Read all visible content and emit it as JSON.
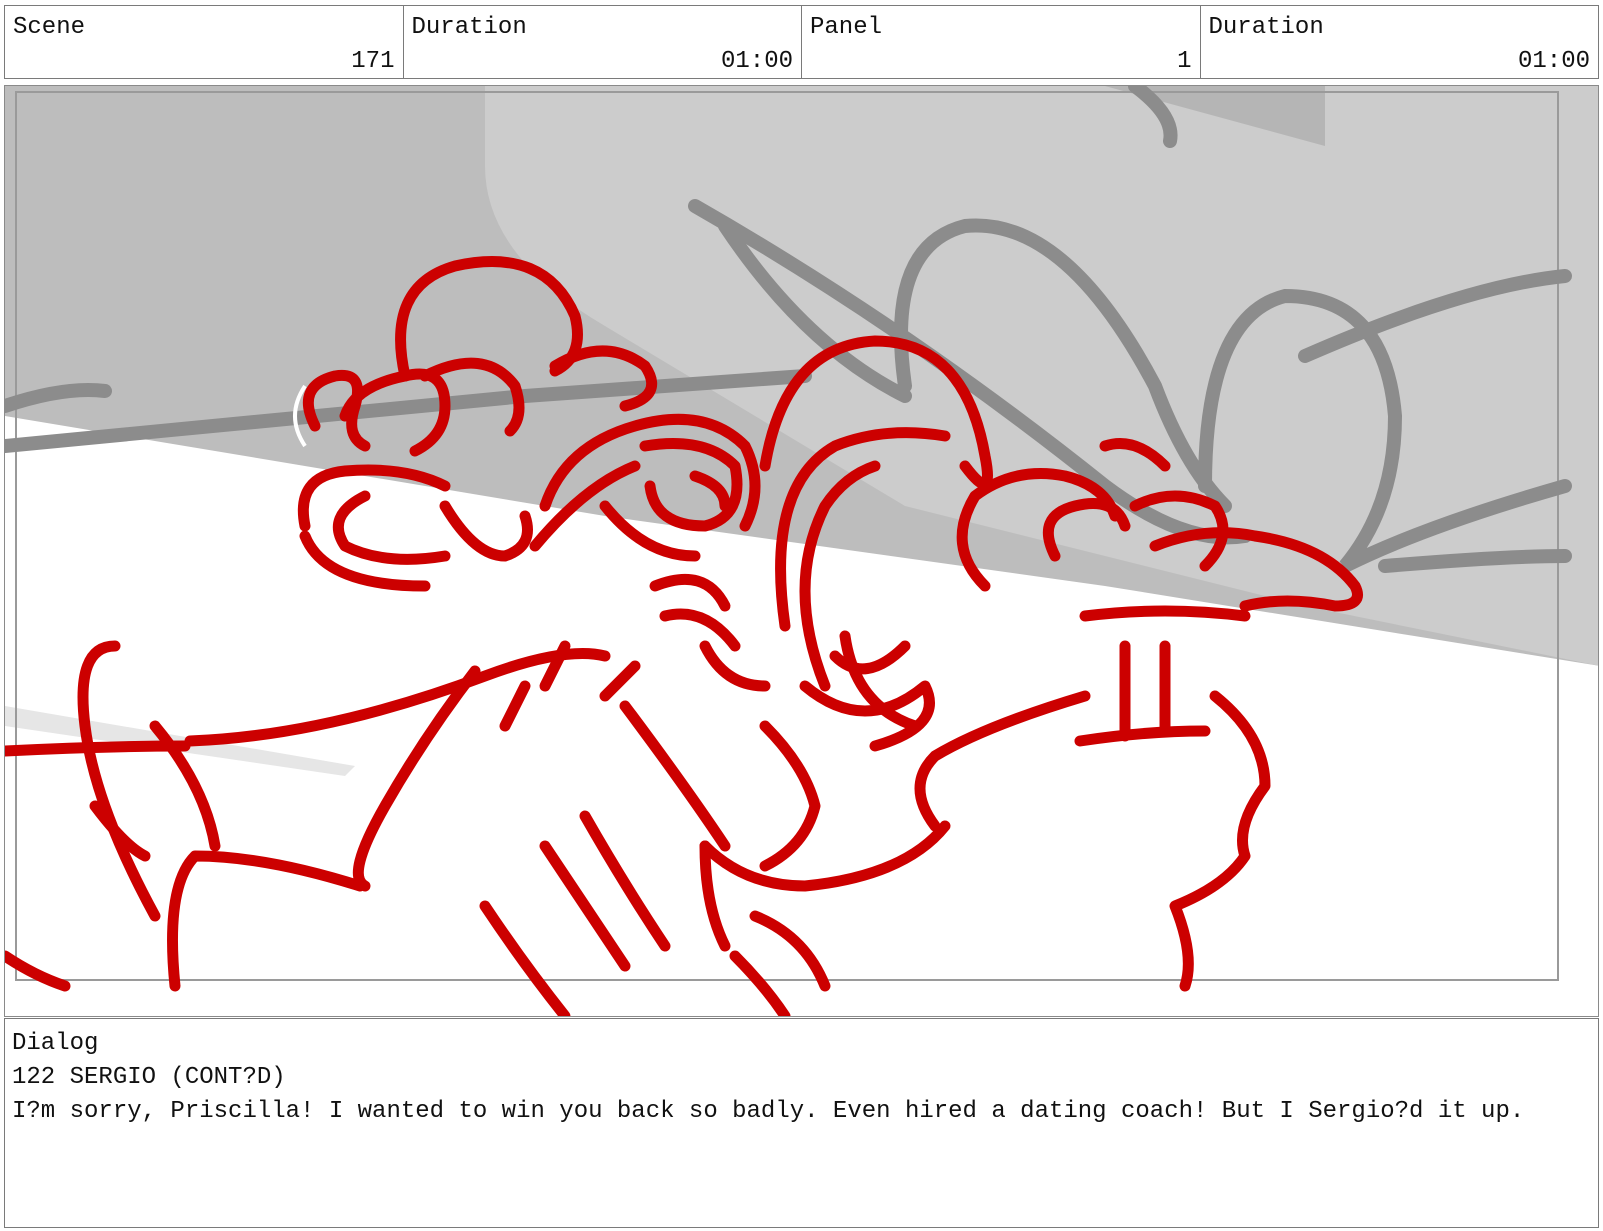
{
  "header": {
    "scene_label": "Scene",
    "scene_value": "171",
    "scene_duration_label": "Duration",
    "scene_duration_value": "01:00",
    "panel_label": "Panel",
    "panel_value": "1",
    "panel_duration_label": "Duration",
    "panel_duration_value": "01:00"
  },
  "dialog": {
    "label": "Dialog",
    "character_line": "122 SERGIO (CONT?D)",
    "text": "I?m sorry, Priscilla! I wanted to win you back so badly. Even hired a dating coach! But I Sergio?d it up."
  },
  "colors": {
    "sketch_red": "#cc0000",
    "background_gray": "#bdbdbd",
    "shadow_gray": "#8c8c8c"
  }
}
